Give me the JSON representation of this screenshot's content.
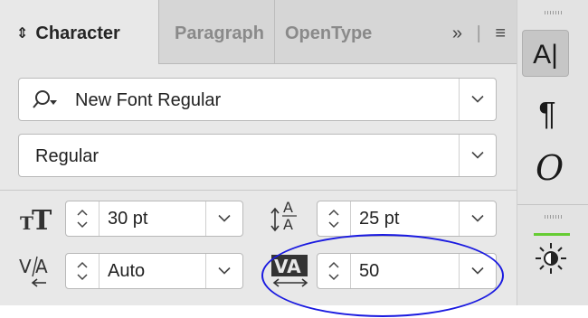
{
  "tabs": [
    {
      "label": "Character",
      "active": true
    },
    {
      "label": "Paragraph",
      "active": false
    },
    {
      "label": "OpenType",
      "active": false
    }
  ],
  "tab_controls": {
    "expand": "»",
    "menu": "≡"
  },
  "font_family": {
    "value": "New Font Regular",
    "icon": "search-icon"
  },
  "font_style": {
    "value": "Regular"
  },
  "font_size": {
    "value": "30 pt",
    "icon": "font-size-icon"
  },
  "leading": {
    "value": "25 pt",
    "icon": "leading-icon"
  },
  "kerning": {
    "value": "Auto",
    "icon": "kerning-icon"
  },
  "tracking": {
    "value": "50",
    "icon": "tracking-icon"
  },
  "side_toolbar": {
    "character": "A|",
    "paragraph": "¶",
    "glyphs": "O"
  },
  "colors": {
    "highlight": "#1a1ae0",
    "accent": "#66cc33",
    "panel": "#e8e8e8"
  }
}
